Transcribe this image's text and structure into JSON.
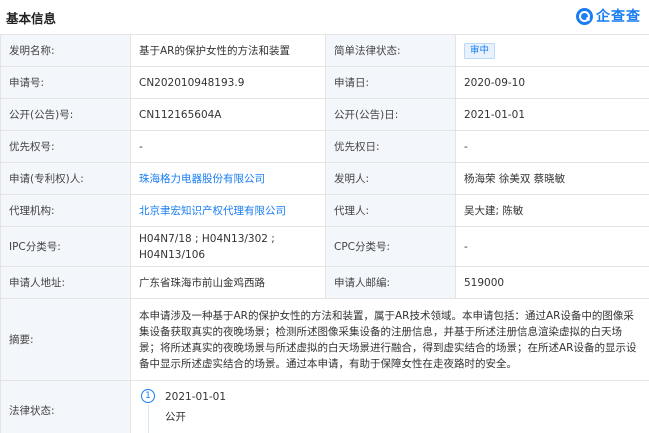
{
  "header": {
    "title": "基本信息",
    "brand": "企查查"
  },
  "rows": {
    "invention_name_label": "发明名称:",
    "invention_name_value": "基于AR的保护女性的方法和装置",
    "legal_status_brief_label": "简单法律状态:",
    "legal_status_brief_value": "审中",
    "application_no_label": "申请号:",
    "application_no_value": "CN202010948193.9",
    "application_date_label": "申请日:",
    "application_date_value": "2020-09-10",
    "publication_no_label": "公开(公告)号:",
    "publication_no_value": "CN112165604A",
    "publication_date_label": "公开(公告)日:",
    "publication_date_value": "2021-01-01",
    "priority_no_label": "优先权号:",
    "priority_no_value": "-",
    "priority_date_label": "优先权日:",
    "priority_date_value": "-",
    "applicant_label": "申请(专利权)人:",
    "applicant_value": "珠海格力电器股份有限公司",
    "inventor_label": "发明人:",
    "inventor_value": "杨海荣 徐美双 蔡晓敏",
    "agency_label": "代理机构:",
    "agency_value": "北京聿宏知识产权代理有限公司",
    "agent_label": "代理人:",
    "agent_value": "吴大建; 陈敏",
    "ipc_label": "IPC分类号:",
    "ipc_value": "H04N7/18 ; H04N13/302 ; H04N13/106",
    "cpc_label": "CPC分类号:",
    "cpc_value": "-",
    "address_label": "申请人地址:",
    "address_value": "广东省珠海市前山金鸡西路",
    "postcode_label": "申请人邮编:",
    "postcode_value": "519000",
    "abstract_label": "摘要:",
    "abstract_value": "本申请涉及一种基于AR的保护女性的方法和装置，属于AR技术领域。本申请包括：通过AR设备中的图像采集设备获取真实的夜晚场景；检测所述图像采集设备的注册信息，并基于所述注册信息渲染虚拟的白天场景；将所述真实的夜晚场景与所述虚拟的白天场景进行融合，得到虚实结合的场景；在所述AR设备的显示设备中显示所述虚实结合的场景。通过本申请，有助于保障女性在走夜路时的安全。",
    "legal_status_label": "法律状态:",
    "legal_steps": [
      {
        "num": "1",
        "date": "2021-01-01",
        "status": "公开"
      }
    ]
  }
}
